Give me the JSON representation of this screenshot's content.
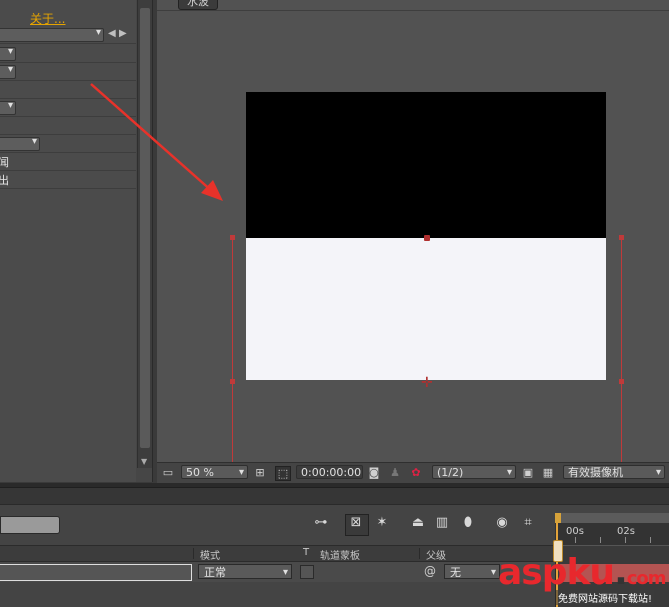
{
  "effect_controls": {
    "about_link": "关于...",
    "row_texts": [
      "闻",
      "出"
    ]
  },
  "viewer": {
    "tab_label": "水波"
  },
  "viewer_toolbar": {
    "zoom_value": "50 %",
    "timecode": "0:00:00:00",
    "resolution_value": "(1/2)",
    "camera_value": "有效摄像机"
  },
  "timeline": {
    "columns": {
      "mode": "模式",
      "t": "T",
      "track_matte": "轨道蒙板",
      "parent": "父级"
    },
    "layer": {
      "mode_value": "正常",
      "parent_value": "无"
    },
    "ruler": {
      "labels": [
        "00s",
        "02s"
      ]
    }
  },
  "watermark": {
    "logo_main": "aspku",
    "logo_tld": "com",
    "tagline": "免费网站源码下载站!"
  },
  "colors": {
    "accent_orange": "#e6a400",
    "guide_red": "#c03a3a",
    "layer_bar": "#b45452",
    "watermark_red": "#e8282d"
  }
}
